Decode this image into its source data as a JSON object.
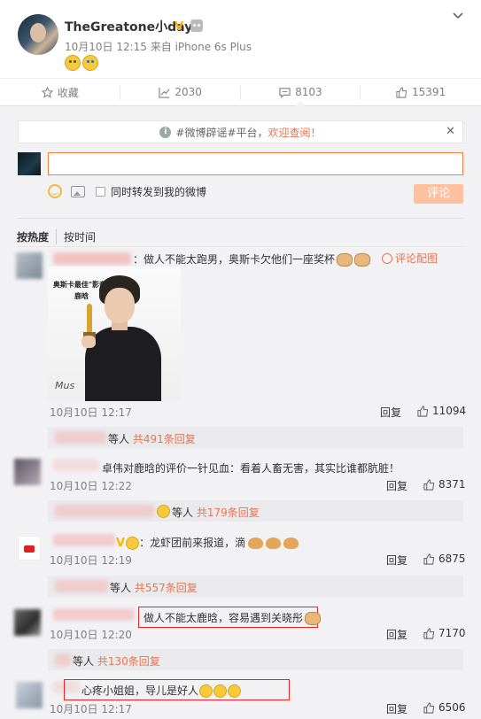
{
  "post": {
    "username": "TheGreatone小day",
    "meta": "10月10日 12:15 来自 iPhone 6s Plus"
  },
  "actions": [
    {
      "label": "收藏",
      "icon": "star-icon"
    },
    {
      "label": "2030",
      "icon": "repost-icon"
    },
    {
      "label": "8103",
      "icon": "comment-icon"
    },
    {
      "label": "15391",
      "icon": "thumbs-up-icon"
    }
  ],
  "notice": {
    "prefix": "#微博辟谣#平台，",
    "link": "欢迎查阅！"
  },
  "composer": {
    "input_value": "",
    "repost_label": "同时转发到我的微博",
    "submit_label": "评论"
  },
  "sort": {
    "hot": "按热度",
    "time": "按时间"
  },
  "comments": [
    {
      "text": "：做人不能太跑男，奥斯卡欠他们一座奖杯",
      "pic_link": "评论配图",
      "time": "10月10日 12:17",
      "reply": "回复",
      "likes": "11094",
      "pic_caption": "奥斯卡最佳\"影帝\" 鹿晗",
      "pic_sign": "Mus",
      "sub_suffix": "等人",
      "sub_count": "共491条回复"
    },
    {
      "text": "卓伟对鹿晗的评价一针见血：看着人畜无害，其实比谁都肮脏！",
      "time": "10月10日 12:22",
      "reply": "回复",
      "likes": "8371",
      "sub_suffix": "等人",
      "sub_count": "共179条回复"
    },
    {
      "text": "：龙虾团前来报道，滴",
      "time": "10月10日 12:19",
      "reply": "回复",
      "likes": "6875",
      "sub_suffix": "等人",
      "sub_count": "共557条回复"
    },
    {
      "text": "做人不能太鹿晗，容易遇到关晓彤",
      "time": "10月10日 12:20",
      "reply": "回复",
      "likes": "7170",
      "sub_suffix": "等人",
      "sub_count": "共130条回复"
    },
    {
      "text": "心疼小姐姐，导儿是好人",
      "time": "10月10日 12:17",
      "reply": "回复",
      "likes": "6506"
    }
  ]
}
